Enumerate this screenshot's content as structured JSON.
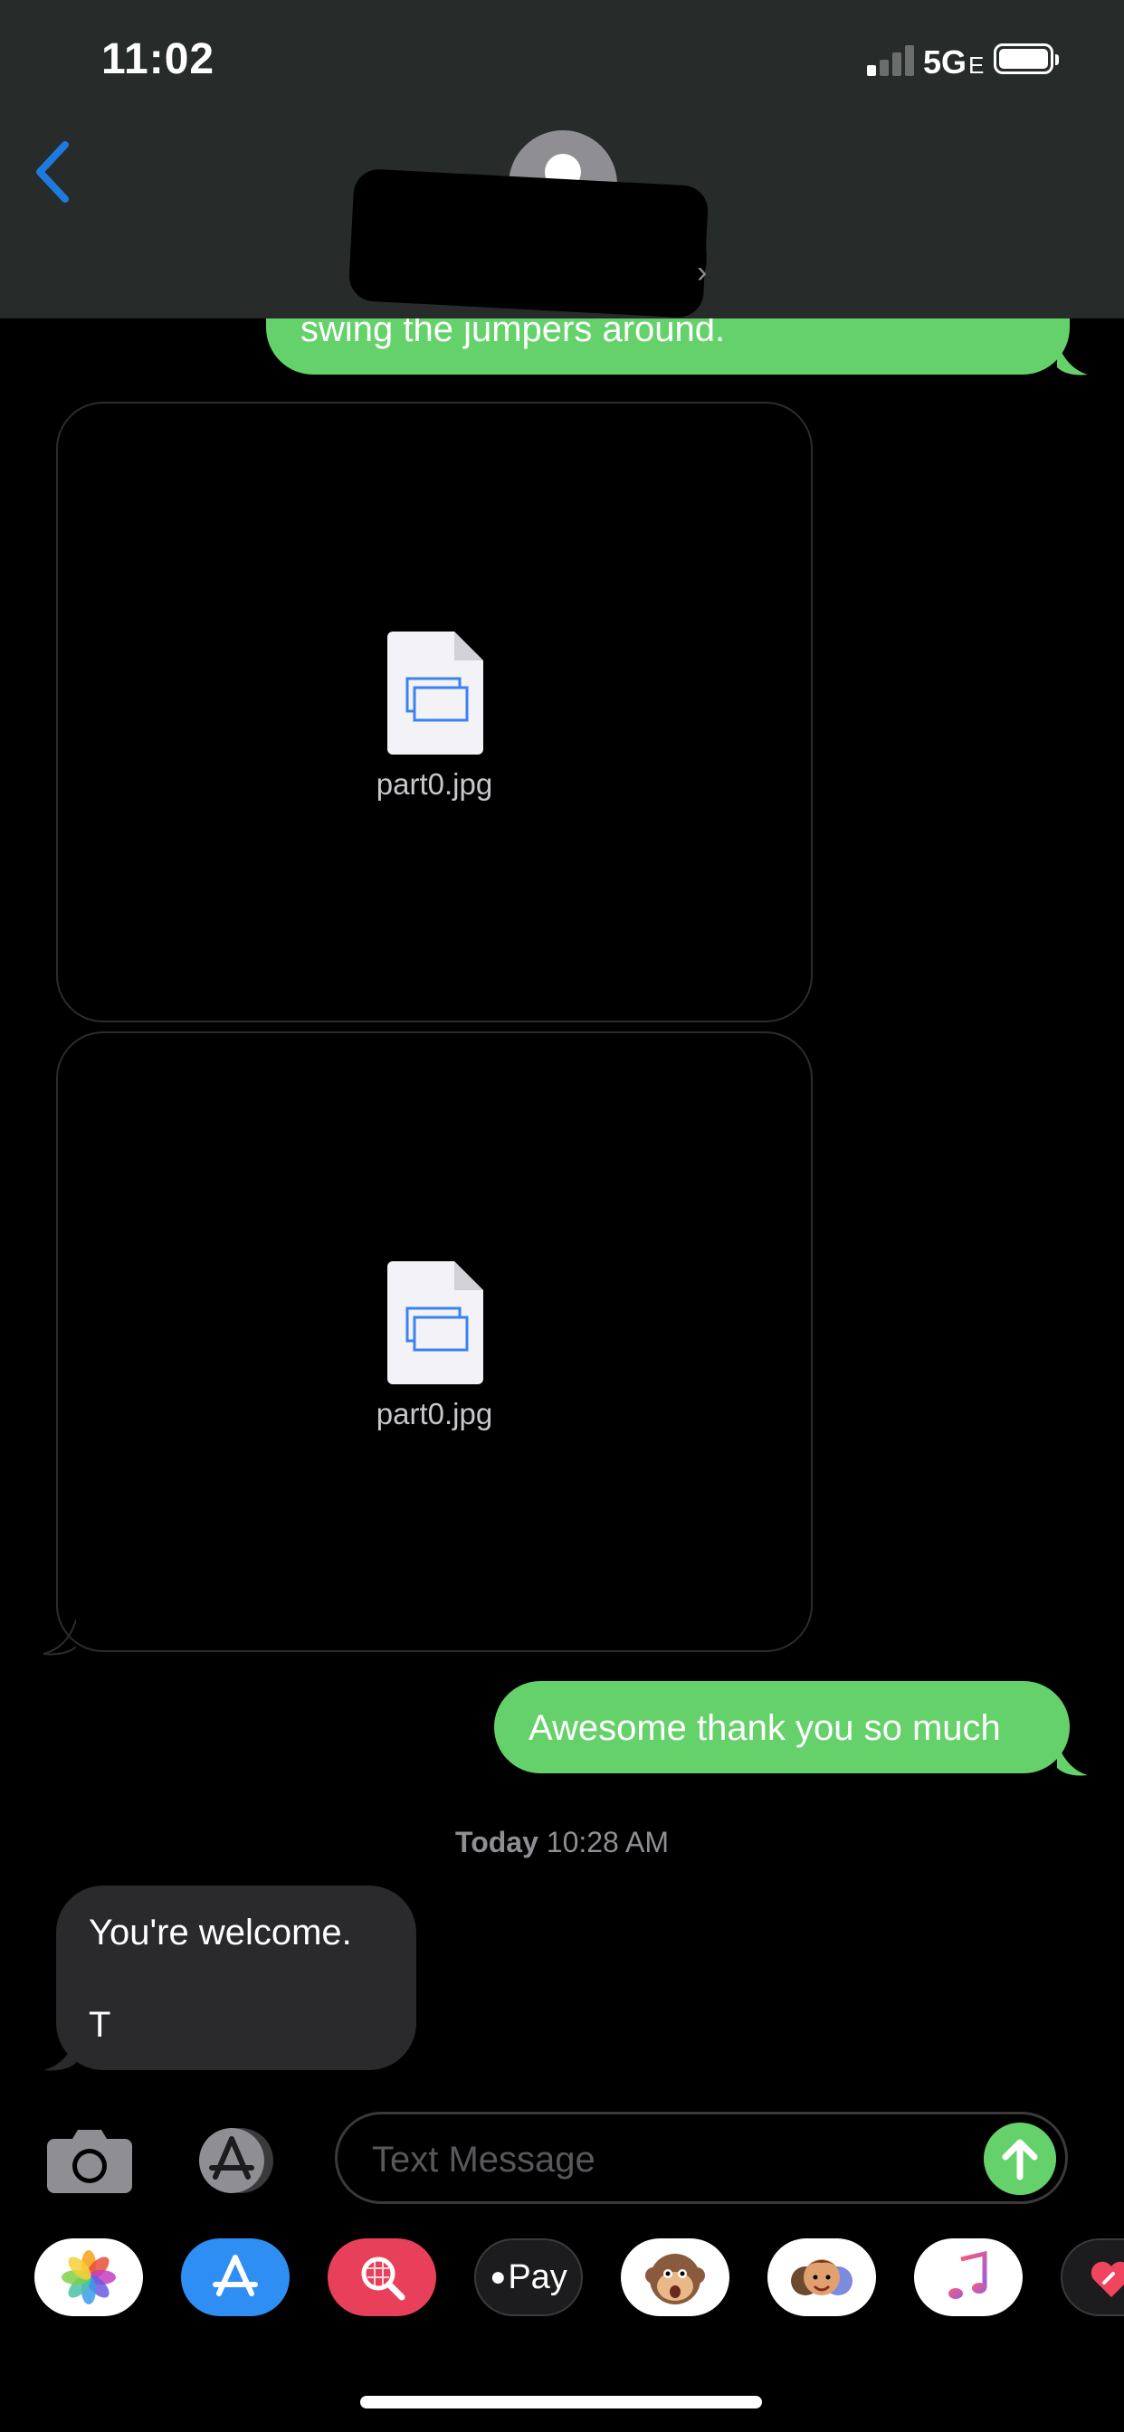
{
  "status_bar": {
    "time": "11:02",
    "network": "5G",
    "network_suffix": "E"
  },
  "header": {
    "back_icon": "chevron-left-icon",
    "avatar_icon": "contact-avatar-icon",
    "details_icon": "chevron-right-icon"
  },
  "messages": {
    "partial_sent": "swing the jumpers around.",
    "attachments": [
      {
        "file_name": "part0.jpg",
        "icon": "image-file-icon"
      },
      {
        "file_name": "part0.jpg",
        "icon": "image-file-icon"
      }
    ],
    "sent_awesome": "Awesome thank you so much",
    "timestamp_day": "Today",
    "timestamp_time": "10:28 AM",
    "received_line1": "You're welcome.",
    "received_line2": "T"
  },
  "composer": {
    "placeholder": "Text Message",
    "camera_icon": "camera-icon",
    "apps_icon": "app-store-icon",
    "send_icon": "send-arrow-icon"
  },
  "app_drawer": {
    "apps": [
      {
        "name": "photos-app-icon"
      },
      {
        "name": "app-store-app-icon"
      },
      {
        "name": "image-search-app-icon"
      },
      {
        "name": "apple-pay-app-icon",
        "label": "Pay"
      },
      {
        "name": "animoji-monkey-app-icon"
      },
      {
        "name": "memoji-app-icon"
      },
      {
        "name": "music-app-icon"
      },
      {
        "name": "digital-touch-app-icon"
      }
    ]
  },
  "colors": {
    "sent_bubble": "#65d16a",
    "received_bubble": "#2a2a2d",
    "header_bg": "#272b29",
    "accent_blue": "#1f7ae0"
  }
}
